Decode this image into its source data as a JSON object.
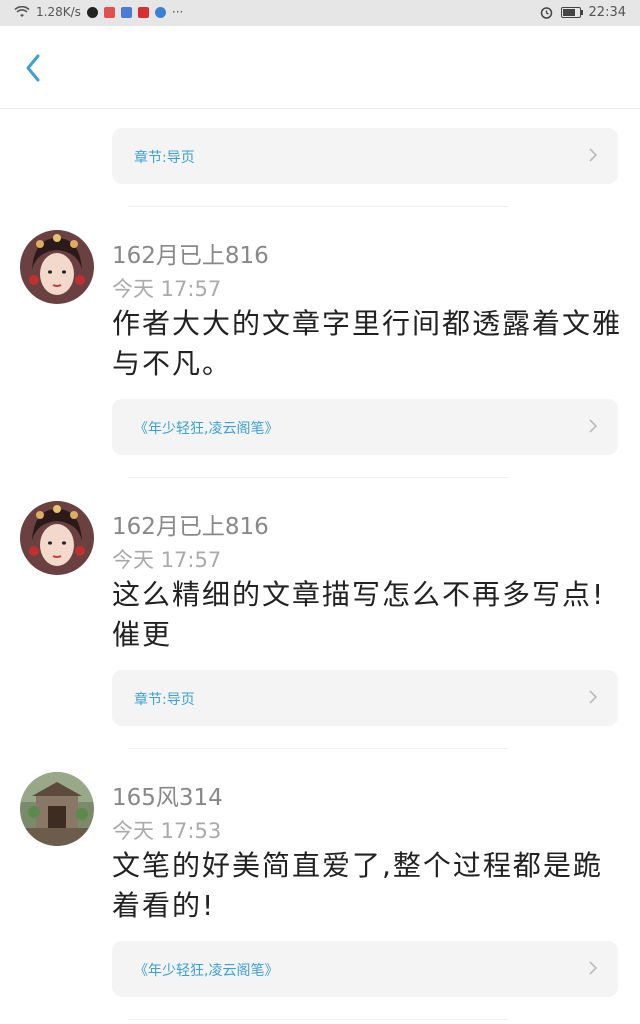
{
  "status_bar": {
    "network_speed": "1.28K/s",
    "time": "22:34"
  },
  "header": {
    "back_icon": "chevron-left-icon"
  },
  "top_card": {
    "label": "章节:导页"
  },
  "comments": [
    {
      "username": "162月已上816",
      "time": "今天 17:57",
      "content": "作者大大的文章字里行间都透露着文雅与不凡。",
      "link": "《年少轻狂,凌云阁笔》"
    },
    {
      "username": "162月已上816",
      "time": "今天 17:57",
      "content": "这么精细的文章描写怎么不再多写点!催更",
      "link": "章节:导页"
    },
    {
      "username": "165风314",
      "time": "今天 17:53",
      "content": "文笔的好美简直爱了,整个过程都是跪着看的!",
      "link": "《年少轻狂,凌云阁笔》"
    }
  ],
  "colors": {
    "accent": "#3ca0d8",
    "card_bg": "#f4f4f4",
    "status_bar_bg": "#e6e6e6"
  }
}
